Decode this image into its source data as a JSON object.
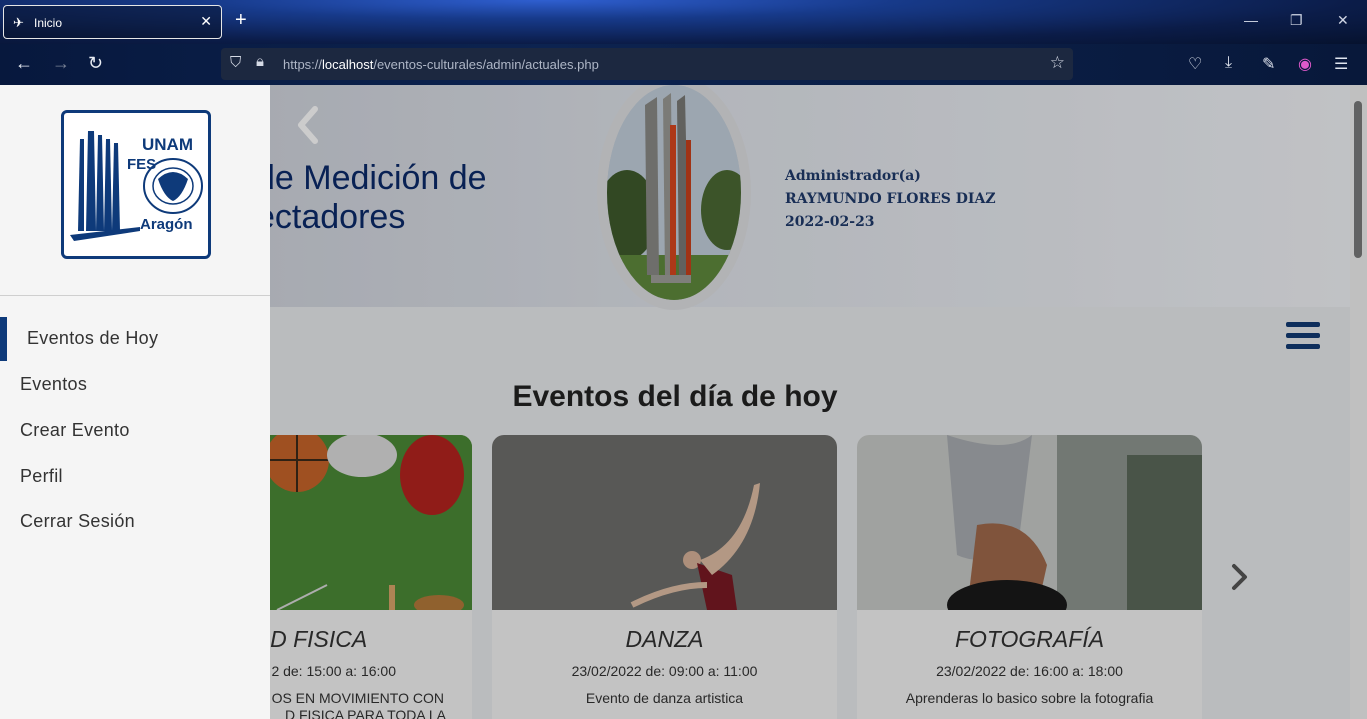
{
  "browser": {
    "tab_title": "Inicio",
    "tab_close": "✕",
    "new_tab": "+",
    "url_host": "localhost",
    "url_prefix": "https://",
    "url_path": "/eventos-culturales/admin/actuales.php"
  },
  "header": {
    "title_line1": "de Medición de",
    "title_line2": "ectadores",
    "admin_role": "Administrador(a)",
    "admin_name": "RAYMUNDO FLORES DIAZ",
    "admin_date": "2022-02-23"
  },
  "sidebar": {
    "logo_top": "UNAM",
    "logo_fes": "FES",
    "logo_bottom": "Aragón",
    "items": [
      {
        "label": "Eventos de Hoy",
        "active": true
      },
      {
        "label": "Eventos"
      },
      {
        "label": "Crear Evento"
      },
      {
        "label": "Perfil"
      },
      {
        "label": "Cerrar Sesión"
      }
    ]
  },
  "main": {
    "section_title": "Eventos del día de hoy",
    "cards": [
      {
        "title": "IDAD FISICA",
        "date": "2 de: 15:00 a: 16:00",
        "desc": "OS EN MOVIMIENTO CON",
        "desc2": "D FISICA PARA TODA LA"
      },
      {
        "title": "DANZA",
        "date": "23/02/2022 de: 09:00 a: 11:00",
        "desc": "Evento de danza artistica"
      },
      {
        "title": "FOTOGRAFÍA",
        "date": "23/02/2022 de: 16:00 a: 18:00",
        "desc": "Aprenderas lo basico sobre la fotografia"
      }
    ]
  },
  "colors": {
    "brand_blue": "#0e3a7a",
    "sidebar_bg": "#f5f5f5"
  }
}
